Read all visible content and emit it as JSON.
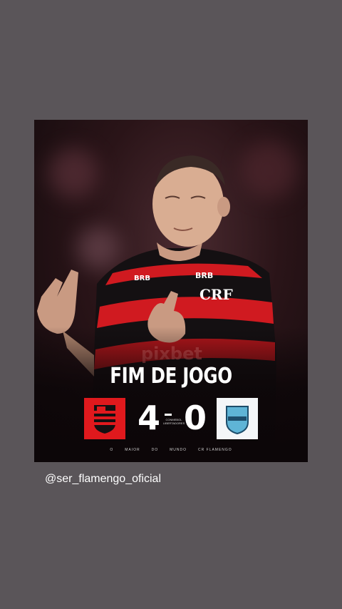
{
  "post": {
    "headline": "FIM DE JOGO",
    "home_team": {
      "name": "Flamengo",
      "score": "4",
      "color": "#e0191d"
    },
    "away_team": {
      "name": "Bolívar",
      "score": "0",
      "color": "#5fb4d6"
    },
    "competition": "CONMEBOL LIBERTADORES",
    "footer": {
      "words": [
        "O",
        "MAIOR",
        "DO",
        "MUNDO"
      ],
      "sponsor": "CR FLAMENGO",
      "brand_label": "BRB",
      "kit_label": "pixbet"
    }
  },
  "caption": {
    "username": "@ser_flamengo_oficial"
  },
  "colors": {
    "background": "#5a5559",
    "kit_red": "#d01a20",
    "kit_black": "#141012"
  }
}
